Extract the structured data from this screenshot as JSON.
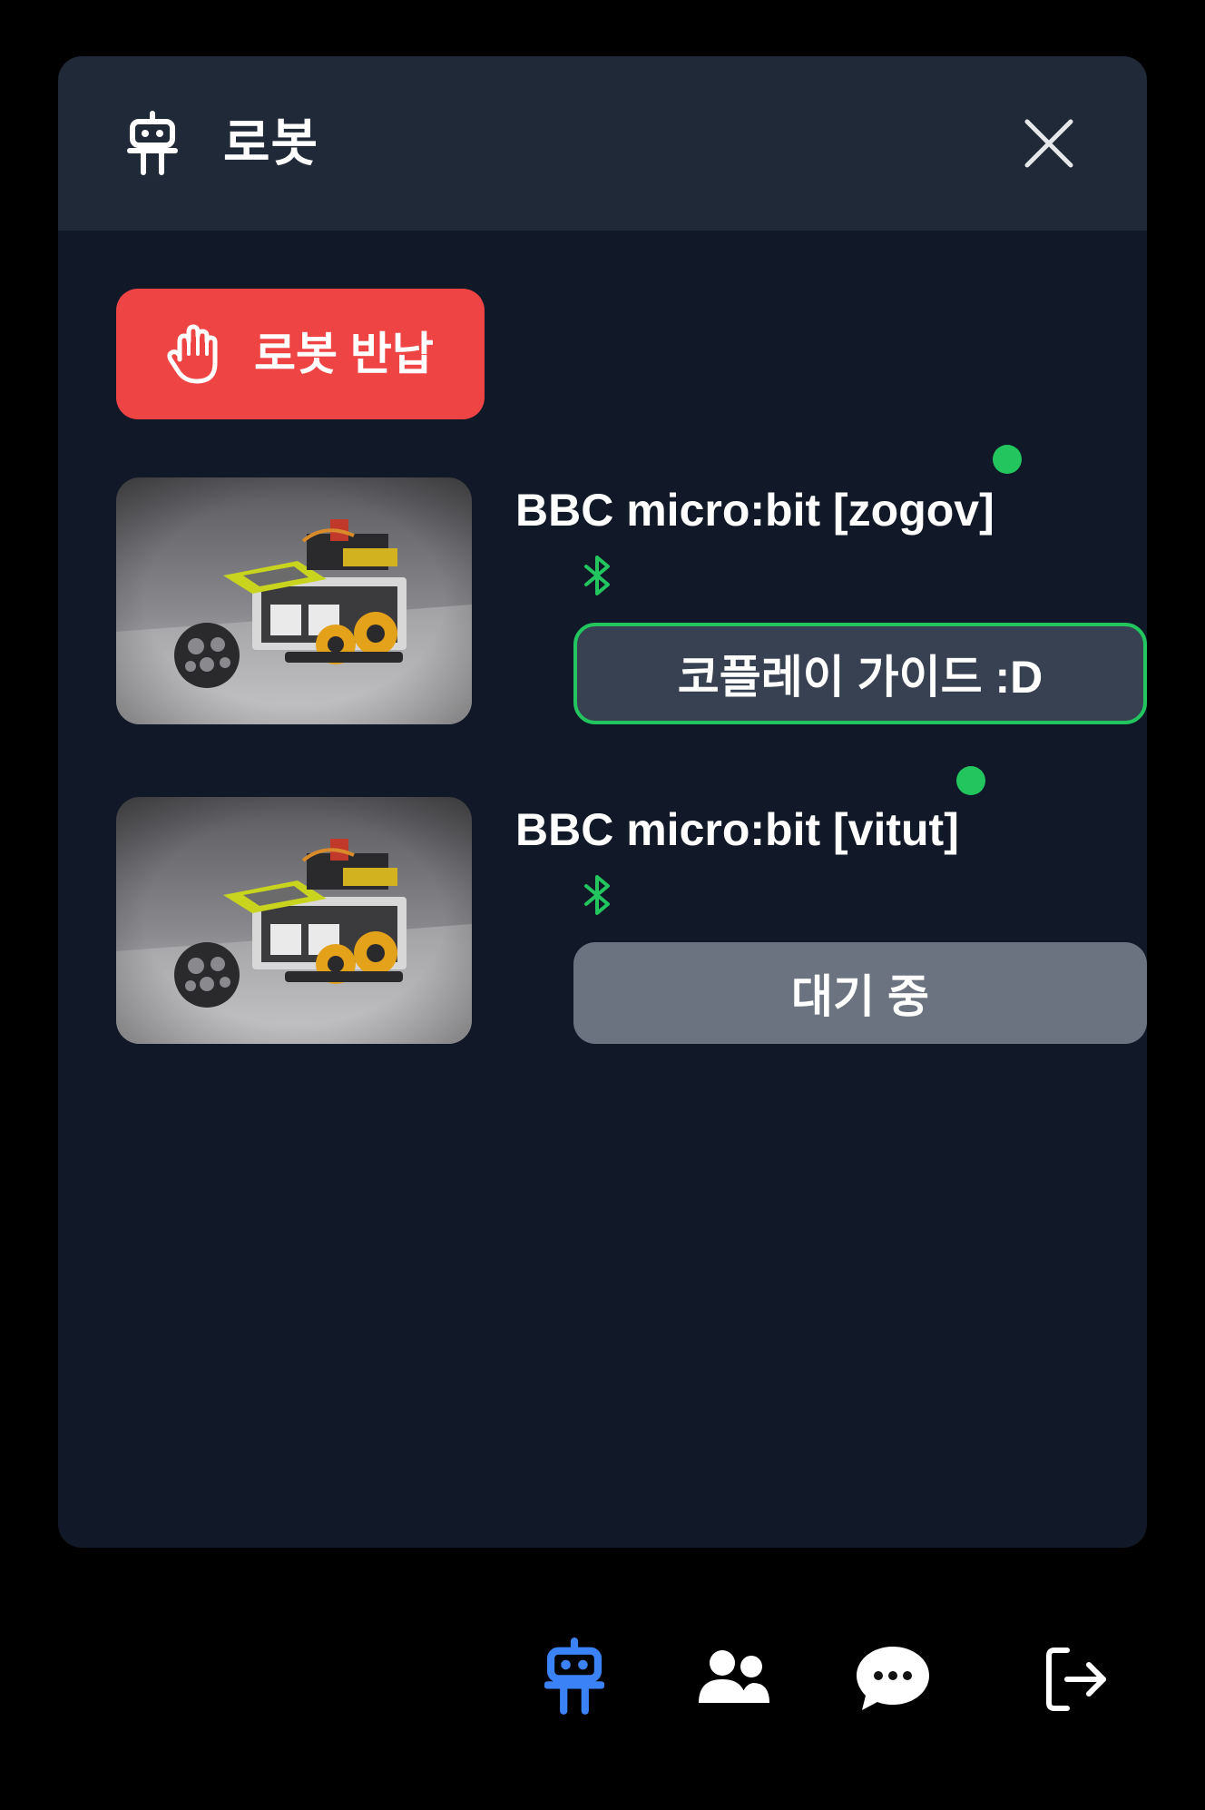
{
  "header": {
    "icon": "robot-icon",
    "title": "로봇",
    "close_icon": "close-icon"
  },
  "return_button": {
    "icon": "hand-icon",
    "label": "로봇 반납",
    "color": "#ef4444"
  },
  "robots": [
    {
      "name": "BBC micro:bit [zogov]",
      "status_color": "#22c55e",
      "connection_icon": "bluetooth-icon",
      "action_label": "코플레이 가이드 :D",
      "action_style": "outlined-green"
    },
    {
      "name": "BBC micro:bit [vitut]",
      "status_color": "#22c55e",
      "connection_icon": "bluetooth-icon",
      "action_label": "대기 중",
      "action_style": "gray"
    }
  ],
  "bottom_nav": {
    "items": [
      {
        "icon": "robot-icon",
        "active": true,
        "color": "#3b82f6"
      },
      {
        "icon": "users-icon",
        "active": false
      },
      {
        "icon": "chat-icon",
        "active": false
      },
      {
        "icon": "logout-icon",
        "active": false
      }
    ]
  }
}
